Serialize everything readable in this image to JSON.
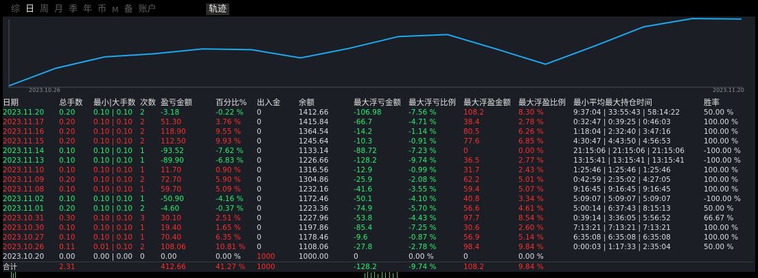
{
  "tabs": [
    "综",
    "日",
    "周",
    "月",
    "季",
    "年",
    "币",
    "M",
    "备",
    "账户"
  ],
  "active_tab": "日",
  "track_tab": "轨迹",
  "chart": {
    "x_start_label": "2023.10.26",
    "x_end_label": "2023.11.20",
    "line_color": "#1ea8f0"
  },
  "chart_data": {
    "type": "line",
    "x": [
      "2023.10.26",
      "2023.10.27",
      "2023.10.30",
      "2023.10.31",
      "2023.11.01",
      "2023.11.02",
      "2023.11.08",
      "2023.11.09",
      "2023.11.10",
      "2023.11.13",
      "2023.11.14",
      "2023.11.15",
      "2023.11.16",
      "2023.11.17",
      "2023.11.20"
    ],
    "values": [
      1108.06,
      1178.46,
      1197.86,
      1227.96,
      1223.36,
      1172.46,
      1232.16,
      1304.86,
      1316.56,
      1226.68,
      1133.14,
      1245.64,
      1364.54,
      1415.84,
      1412.66
    ],
    "xlabel": "",
    "ylabel": ""
  },
  "columns": [
    "日期",
    "总手数",
    "最小|大手数",
    "次数",
    "盈亏金额",
    "百分比%",
    "出入金",
    "余额",
    "最大浮亏金额",
    "最大浮亏比例",
    "最大浮盈金额",
    "最大浮盈比例",
    "最小平均最大持仓时间",
    "胜率"
  ],
  "rows": [
    {
      "date": "2023.11.20",
      "lots": "0.20",
      "minmax": "0.10 | 0.10",
      "count": "2",
      "pnl": "-3.18",
      "pct": "-0.22 %",
      "io": "0",
      "bal": "1412.66",
      "mfl": "-106.98",
      "mflp": "-7.56 %",
      "mfp": "108.2",
      "mfpp": "8.30 %",
      "hold": "9:37:04 | 33:55:43 | 58:14:22",
      "win": "50.00 %",
      "s": "neg"
    },
    {
      "date": "2023.11.17",
      "lots": "0.20",
      "minmax": "0.10 | 0.10",
      "count": "2",
      "pnl": "51.30",
      "pct": "3.76 %",
      "io": "0",
      "bal": "1415.84",
      "mfl": "-66.7",
      "mflp": "-4.71 %",
      "mfp": "38.4",
      "mfpp": "2.78 %",
      "hold": "0:32:47 | 0:39:25 | 0:46:03",
      "win": "100.00 %",
      "s": "pos"
    },
    {
      "date": "2023.11.16",
      "lots": "0.20",
      "minmax": "0.10 | 0.10",
      "count": "2",
      "pnl": "118.90",
      "pct": "9.55 %",
      "io": "0",
      "bal": "1364.54",
      "mfl": "-14.2",
      "mflp": "-1.14 %",
      "mfp": "80.5",
      "mfpp": "6.26 %",
      "hold": "1:18:04 | 2:32:40 | 3:47:16",
      "win": "100.00 %",
      "s": "pos"
    },
    {
      "date": "2023.11.15",
      "lots": "0.20",
      "minmax": "0.10 | 0.10",
      "count": "2",
      "pnl": "112.50",
      "pct": "9.93 %",
      "io": "0",
      "bal": "1245.64",
      "mfl": "-10.3",
      "mflp": "-0.91 %",
      "mfp": "77.6",
      "mfpp": "6.85 %",
      "hold": "4:30:47 | 4:43:50 | 4:56:53",
      "win": "100.00 %",
      "s": "pos"
    },
    {
      "date": "2023.11.14",
      "lots": "0.10",
      "minmax": "0.10 | 0.10",
      "count": "1",
      "pnl": "-93.52",
      "pct": "-7.62 %",
      "io": "0",
      "bal": "1133.14",
      "mfl": "-88.72",
      "mflp": "-7.23 %",
      "mfp": "0",
      "mfpp": "0.00 %",
      "hold": "21:15:06 | 21:15:06 | 21:15:06",
      "win": "-100.00 %",
      "s": "neg"
    },
    {
      "date": "2023.11.13",
      "lots": "0.10",
      "minmax": "0.10 | 0.10",
      "count": "1",
      "pnl": "-89.90",
      "pct": "-6.83 %",
      "io": "0",
      "bal": "1226.66",
      "mfl": "-128.2",
      "mflp": "-9.74 %",
      "mfp": "36.5",
      "mfpp": "2.77 %",
      "hold": "13:15:41 | 13:15:41 | 13:15:41",
      "win": "-100.00 %",
      "s": "neg"
    },
    {
      "date": "2023.11.10",
      "lots": "0.10",
      "minmax": "0.10 | 0.10",
      "count": "1",
      "pnl": "11.70",
      "pct": "0.90 %",
      "io": "0",
      "bal": "1316.56",
      "mfl": "-12.9",
      "mflp": "-0.99 %",
      "mfp": "31.7",
      "mfpp": "2.43 %",
      "hold": "1:25:46 | 1:25:46 | 1:25:46",
      "win": "100.00 %",
      "s": "pos"
    },
    {
      "date": "2023.11.09",
      "lots": "0.20",
      "minmax": "0.10 | 0.10",
      "count": "2",
      "pnl": "72.70",
      "pct": "5.90 %",
      "io": "0",
      "bal": "1304.86",
      "mfl": "-25.9",
      "mflp": "-2.08 %",
      "mfp": "62.2",
      "mfpp": "5.01 %",
      "hold": "0:42:59 | 2:35:02 | 4:27:05",
      "win": "100.00 %",
      "s": "pos"
    },
    {
      "date": "2023.11.08",
      "lots": "0.10",
      "minmax": "0.10 | 0.10",
      "count": "1",
      "pnl": "59.70",
      "pct": "5.09 %",
      "io": "0",
      "bal": "1232.16",
      "mfl": "-41.6",
      "mflp": "-3.55 %",
      "mfp": "59.4",
      "mfpp": "5.07 %",
      "hold": "9:16:45 | 9:16:45 | 9:16:45",
      "win": "100.00 %",
      "s": "pos"
    },
    {
      "date": "2023.11.02",
      "lots": "0.10",
      "minmax": "0.10 | 0.10",
      "count": "1",
      "pnl": "-50.90",
      "pct": "-4.16 %",
      "io": "0",
      "bal": "1172.46",
      "mfl": "-50.1",
      "mflp": "-4.10 %",
      "mfp": "40.8",
      "mfpp": "3.34 %",
      "hold": "5:09:07 | 5:09:07 | 5:09:07",
      "win": "-100.00 %",
      "s": "neg"
    },
    {
      "date": "2023.11.01",
      "lots": "0.20",
      "minmax": "0.10 | 0.10",
      "count": "2",
      "pnl": "-4.60",
      "pct": "-0.37 %",
      "io": "0",
      "bal": "1223.36",
      "mfl": "-74.9",
      "mflp": "-5.70 %",
      "mfp": "56.6",
      "mfpp": "4.61 %",
      "hold": "5:00:14 | 6:37:43 | 8:15:13",
      "win": "50.00 %",
      "s": "neg"
    },
    {
      "date": "2023.10.31",
      "lots": "0.30",
      "minmax": "0.10 | 0.10",
      "count": "3",
      "pnl": "30.10",
      "pct": "2.51 %",
      "io": "0",
      "bal": "1227.96",
      "mfl": "-53.8",
      "mflp": "-4.43 %",
      "mfp": "97.7",
      "mfpp": "8.54 %",
      "hold": "0:39:14 | 3:36:05 | 5:56:52",
      "win": "66.67 %",
      "s": "pos"
    },
    {
      "date": "2023.10.30",
      "lots": "0.10",
      "minmax": "0.10 | 0.10",
      "count": "1",
      "pnl": "19.40",
      "pct": "1.65 %",
      "io": "0",
      "bal": "1197.86",
      "mfl": "-85.4",
      "mflp": "-7.25 %",
      "mfp": "30.6",
      "mfpp": "2.60 %",
      "hold": "7:13:21 | 7:13:21 | 7:13:21",
      "win": "100.00 %",
      "s": "pos"
    },
    {
      "date": "2023.10.27",
      "lots": "0.10",
      "minmax": "0.10 | 0.10",
      "count": "1",
      "pnl": "70.40",
      "pct": "6.35 %",
      "io": "0",
      "bal": "1178.46",
      "mfl": "-9.6",
      "mflp": "-0.87 %",
      "mfp": "56.9",
      "mfpp": "5.14 %",
      "hold": "6:35:08 | 6:35:08 | 6:35:08",
      "win": "100.00 %",
      "s": "pos"
    },
    {
      "date": "2023.10.26",
      "lots": "0.11",
      "minmax": "0.01 | 0.10",
      "count": "2",
      "pnl": "108.06",
      "pct": "10.81 %",
      "io": "0",
      "bal": "1108.06",
      "mfl": "-27.8",
      "mflp": "-2.78 %",
      "mfp": "98.4",
      "mfpp": "9.84 %",
      "hold": "0:00:03 | 1:17:33 | 2:35:04",
      "win": "50.00 %",
      "s": "pos"
    },
    {
      "date": "2023.10.20",
      "lots": "0.00",
      "minmax": "0.00 | 0.00",
      "count": "0",
      "pnl": "0.00",
      "pct": "0.00 %",
      "io": "1000",
      "bal": "1000.00",
      "mfl": "0",
      "mflp": "0.00 %",
      "mfp": "0",
      "mfpp": "0.00 %",
      "hold": "",
      "win": "",
      "s": "neu"
    }
  ],
  "total": {
    "label": "合计",
    "lots": "2.31",
    "pnl": "412.66",
    "pct": "41.27 %",
    "io": "1000",
    "mfl": "-128.2",
    "mflp": "-9.74 %",
    "mfp": "108.2",
    "mfpp": "9.84 %"
  },
  "colors": {
    "profit": "#ff2c2c",
    "loss": "#27f06c",
    "neutral": "#dcdcdc"
  }
}
